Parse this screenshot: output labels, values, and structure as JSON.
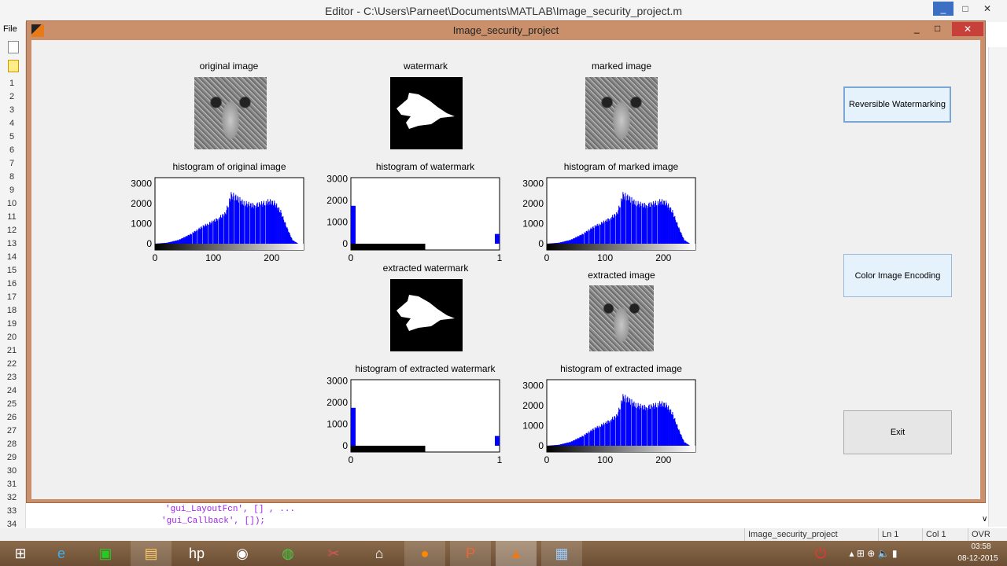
{
  "editor": {
    "title": "Editor - C:\\Users\\Parneet\\Documents\\MATLAB\\Image_security_project.m",
    "menu_file": "File",
    "line_numbers": [
      "1",
      "2",
      "3",
      "4",
      "5",
      "6",
      "7",
      "8",
      "9",
      "10",
      "11",
      "12",
      "13",
      "14",
      "15",
      "16",
      "17",
      "18",
      "19",
      "20",
      "21",
      "22",
      "23",
      "24",
      "25",
      "26",
      "27",
      "28",
      "29",
      "30",
      "31",
      "32",
      "33",
      "34"
    ],
    "code_line_33": "'gui_LayoutFcn',  [] , ...",
    "code_line_34": "'gui_Callback',   []);"
  },
  "figure": {
    "title": "Image_security_project",
    "titles": {
      "original": "original image",
      "watermark": "watermark",
      "marked": "marked image",
      "extracted_watermark": "extracted watermark",
      "extracted_image": "extracted image"
    },
    "buttons": {
      "reversible": "Reversible Watermarking",
      "color": "Color Image Encoding",
      "exit": "Exit"
    }
  },
  "chart_data": [
    {
      "id": "h1",
      "type": "bar",
      "title": "histogram of original image",
      "xlim": [
        0,
        255
      ],
      "ylim": [
        0,
        3300
      ],
      "xticks": [
        "0",
        "100",
        "200"
      ],
      "yticks": [
        "0",
        "1000",
        "2000",
        "3000"
      ],
      "color": "#0000ff",
      "envelope_x": [
        0,
        20,
        40,
        60,
        80,
        100,
        120,
        130,
        140,
        150,
        165,
        180,
        195,
        205,
        215,
        225,
        235,
        245,
        255
      ],
      "envelope_y": [
        0,
        50,
        200,
        500,
        900,
        1200,
        1600,
        2600,
        2450,
        2200,
        2050,
        2100,
        2250,
        2150,
        1700,
        900,
        200,
        0,
        0
      ]
    },
    {
      "id": "h2",
      "type": "bar",
      "title": "histogram of watermark",
      "xlim": [
        0,
        1
      ],
      "ylim": [
        0,
        3050
      ],
      "xticks": [
        "0",
        "1"
      ],
      "yticks": [
        "0",
        "1000",
        "2000",
        "3000"
      ],
      "color": "#0000ff",
      "x": [
        0,
        1
      ],
      "values": [
        1750,
        450
      ]
    },
    {
      "id": "h3",
      "type": "bar",
      "title": "histogram of marked image",
      "xlim": [
        0,
        255
      ],
      "ylim": [
        0,
        3300
      ],
      "xticks": [
        "0",
        "100",
        "200"
      ],
      "yticks": [
        "0",
        "1000",
        "2000",
        "3000"
      ],
      "color": "#0000ff",
      "envelope_x": [
        0,
        20,
        40,
        60,
        80,
        100,
        120,
        130,
        140,
        150,
        165,
        180,
        195,
        205,
        215,
        225,
        235,
        245,
        255
      ],
      "envelope_y": [
        0,
        50,
        200,
        500,
        900,
        1200,
        1600,
        2600,
        2450,
        2200,
        2050,
        2100,
        2250,
        2150,
        1700,
        900,
        200,
        0,
        0
      ]
    },
    {
      "id": "h4",
      "type": "bar",
      "title": "histogram of extracted watermark",
      "xlim": [
        0,
        1
      ],
      "ylim": [
        0,
        3050
      ],
      "xticks": [
        "0",
        "1"
      ],
      "yticks": [
        "0",
        "1000",
        "2000",
        "3000"
      ],
      "color": "#0000ff",
      "x": [
        0,
        1
      ],
      "values": [
        1750,
        450
      ]
    },
    {
      "id": "h5",
      "type": "bar",
      "title": "histogram of extracted image",
      "xlim": [
        0,
        255
      ],
      "ylim": [
        0,
        3300
      ],
      "xticks": [
        "0",
        "100",
        "200"
      ],
      "yticks": [
        "0",
        "1000",
        "2000",
        "3000"
      ],
      "color": "#0000ff",
      "envelope_x": [
        0,
        20,
        40,
        60,
        80,
        100,
        120,
        130,
        140,
        150,
        165,
        180,
        195,
        205,
        215,
        225,
        235,
        245,
        255
      ],
      "envelope_y": [
        0,
        50,
        200,
        500,
        900,
        1200,
        1600,
        2600,
        2450,
        2200,
        2050,
        2100,
        2250,
        2150,
        1700,
        900,
        200,
        0,
        0
      ]
    }
  ],
  "status": {
    "file": "Image_security_project",
    "ln": "Ln  1",
    "col": "Col  1",
    "mode": "OVR"
  },
  "tray": {
    "time": "03:58",
    "date": "08-12-2015"
  }
}
